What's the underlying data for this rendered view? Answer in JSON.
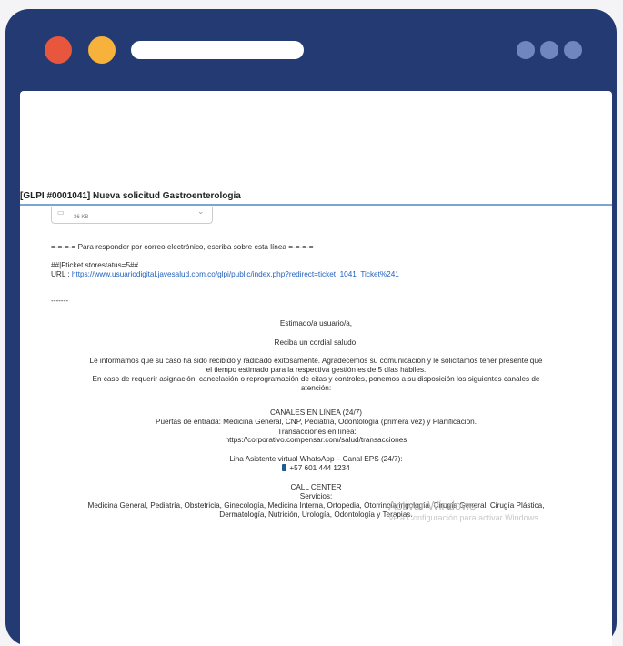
{
  "subject": "[GLPI #0001041] Nueva solicitud Gastroenterologia",
  "attachment": {
    "size": "36 KB"
  },
  "reply_line": "=-=-=-= Para responder por correo electrónico, escriba sobre esta línea =-=-=-=",
  "store_status": "##|Fticket.storestatus=5##",
  "url_label": "URL : ",
  "url": "https://www.usuariodigital.javesalud.com.co/glpi/public/index.php?redirect=ticket_1041_Ticket%241",
  "separator": "-------",
  "greeting": "Estimado/a usuario/a,",
  "salute": "Reciba un cordial saludo.",
  "body": [
    "Le informamos que su caso ha sido recibido y radicado exitosamente. Agradecemos su comunicación y le solicitamos tener presente que",
    "el tiempo estimado para la respectiva gestión es de 5 días hábiles.",
    "En caso de requerir asignación, cancelación o reprogramación de citas y controles, ponemos a su disposición los siguientes canales de",
    "atención:"
  ],
  "online": {
    "title": "CANALES EN LÍNEA (24/7)",
    "entries": "Puertas de entrada: Medicina General, CNP, Pediatría, Odontología (primera vez) y Planificación.",
    "transactions_label": "Transacciones en línea:",
    "transactions_url": "https://corporativo.compensar.com/salud/transacciones"
  },
  "whatsapp": {
    "label": "Lina Asistente virtual WhatsApp – Canal EPS (24/7):",
    "phone": "+57 601 444 1234"
  },
  "call_center": {
    "title": "CALL CENTER",
    "services_label": "Servicios:",
    "services_1": "Medicina General, Pediatría, Obstetricia, Ginecología, Medicina Interna, Ortopedia, Otorrinolaringología, Cirugía General, Cirugía Plástica,",
    "services_2": "Dermatología, Nutrición, Urología, Odontología y Terapias."
  },
  "watermark": {
    "title": "Activar Windows",
    "subtitle": "Ve a Configuración para activar Windows."
  },
  "colors": {
    "frame": "#243a72",
    "red_dot": "#e8563d",
    "yellow_dot": "#f6b23a",
    "link": "#1f5fbf"
  }
}
